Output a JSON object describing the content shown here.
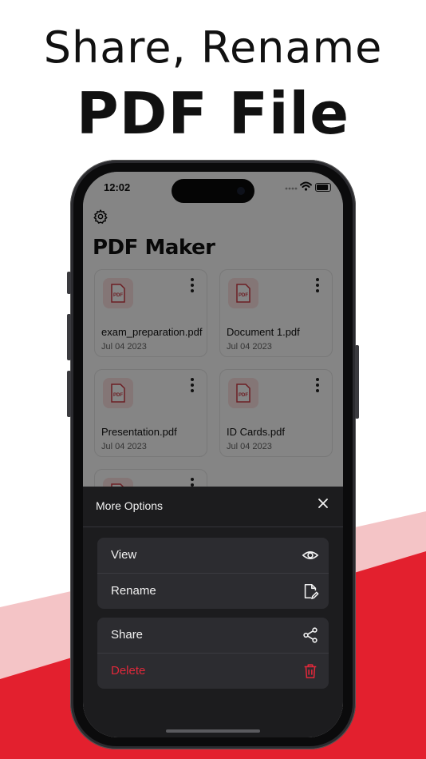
{
  "headline": {
    "line1": "Share, Rename",
    "line2": "PDF File"
  },
  "colors": {
    "accent_red": "#e3202e",
    "light_red": "#f4c4c6",
    "sheet_bg": "#1c1c1e",
    "danger": "#e0283a"
  },
  "status_bar": {
    "time": "12:02"
  },
  "app": {
    "title": "PDF Maker",
    "settings_icon": "gear-icon"
  },
  "files": [
    {
      "name": "exam_preparation.pdf",
      "date": "Jul 04 2023",
      "icon": "pdf-file-icon"
    },
    {
      "name": "Document 1.pdf",
      "date": "Jul 04 2023",
      "icon": "pdf-file-icon"
    },
    {
      "name": "Presentation.pdf",
      "date": "Jul 04 2023",
      "icon": "pdf-file-icon"
    },
    {
      "name": "ID Cards.pdf",
      "date": "Jul 04 2023",
      "icon": "pdf-file-icon"
    },
    {
      "name": "",
      "date": "",
      "icon": "pdf-file-icon"
    }
  ],
  "sheet": {
    "title": "More Options",
    "close_icon": "close-icon",
    "options": [
      {
        "label": "View",
        "icon": "eye-icon"
      },
      {
        "label": "Rename",
        "icon": "edit-file-icon"
      },
      {
        "label": "Share",
        "icon": "share-icon"
      },
      {
        "label": "Delete",
        "icon": "trash-icon"
      }
    ]
  }
}
